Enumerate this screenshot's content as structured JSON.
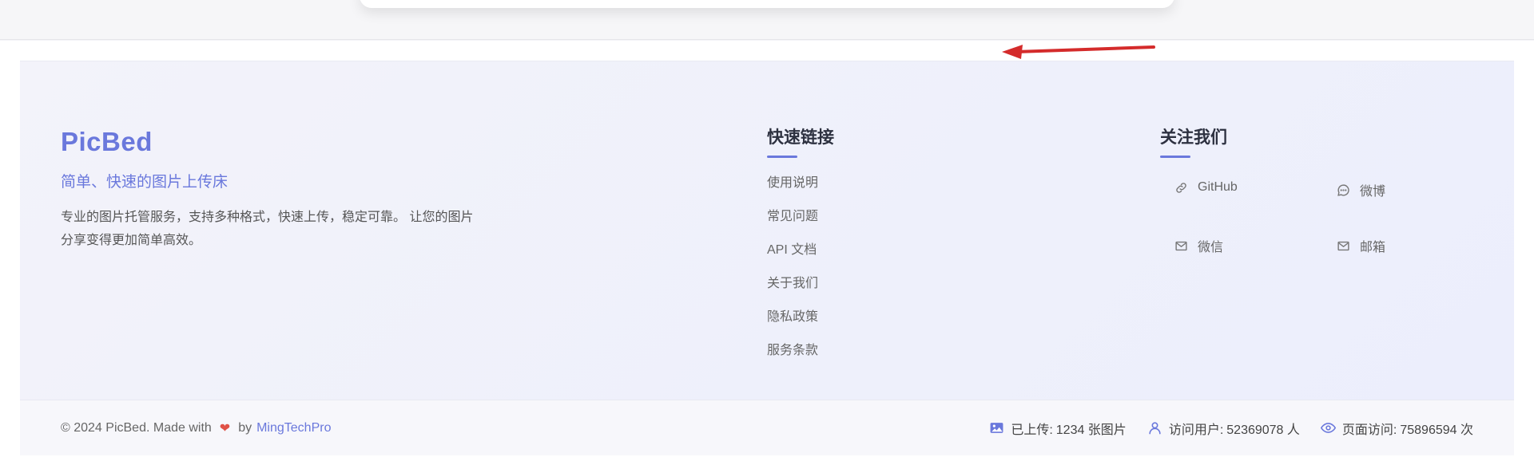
{
  "brand": {
    "title": "PicBed",
    "tagline": "简单、快速的图片上传床",
    "description": "专业的图片托管服务，支持多种格式，快速上传，稳定可靠。 让您的图片分享变得更加简单高效。"
  },
  "quick_links": {
    "title": "快速链接",
    "items": [
      "使用说明",
      "常见问题",
      "API 文档",
      "关于我们",
      "隐私政策",
      "服务条款"
    ]
  },
  "follow": {
    "title": "关注我们",
    "github": "GitHub",
    "weibo": "微博",
    "wechat": "微信",
    "email": "邮箱"
  },
  "footer_bottom": {
    "copyright": "© 2024 PicBed. Made with",
    "by": "by",
    "author": "MingTechPro",
    "uploaded_label": "已上传:",
    "uploaded_value": "1234 张图片",
    "visitors_label": "访问用户:",
    "visitors_value": "52369078 人",
    "pageviews_label": "页面访问:",
    "pageviews_value": "75896594 次"
  },
  "colors": {
    "accent": "#6a78dc",
    "heart": "#e05247",
    "annotation": "#d42b2b"
  }
}
